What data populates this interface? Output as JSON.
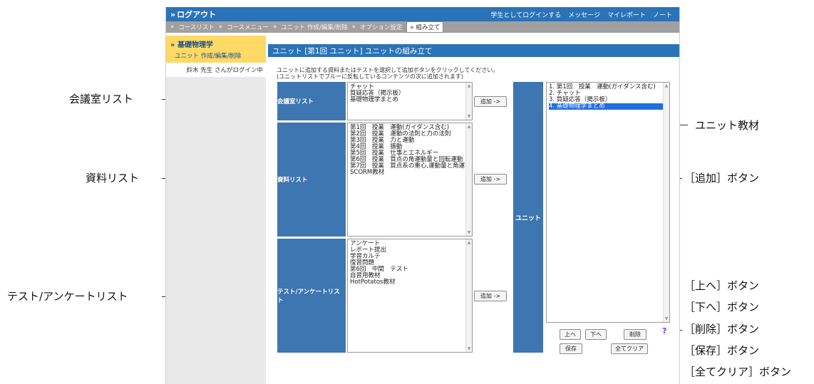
{
  "header": {
    "logout": "ログアウト",
    "links": [
      "学生としてログインする",
      "メッセージ",
      "マイレポート",
      "ノート"
    ]
  },
  "breadcrumb": {
    "items": [
      "コースリスト",
      "コースメニュー",
      "ユニット 作成/編集/削除",
      "オプション設定"
    ],
    "current": "組み立て"
  },
  "sidebar": {
    "course_title": "基礎物理学",
    "sub": "ユニット 作成/編集/削除",
    "login_status": "鈴木 先生 さんがログイン中"
  },
  "main": {
    "title": "ユニット [第1回 ユニット] ユニットの組み立て",
    "instruction_line1": "ユニットに追加する資料またはテストを選択して追加ボタンをクリックしてください。",
    "instruction_line2": "(ユニットリストでブルーに反転しているコンテンツの次に追加されます)"
  },
  "lists": {
    "meeting": {
      "label": "会議室リスト",
      "items": [
        "チャット",
        "質疑応答（掲示板）",
        "基礎物理学まとめ"
      ],
      "add_label": "追加 ->"
    },
    "materials": {
      "label": "資料リスト",
      "items": [
        "第1回　授業　運動(ガイダンス含む)",
        "第2回　授業　運動の法則と力の法則",
        "第3回　授業　力と運動",
        "第4回　授業　振動",
        "第5回　授業　仕事とエネルギー",
        "第6回　授業　質点の角運動量と回転運動",
        "第7回　授業　質点系の重心,運動量と角運",
        "SCORM教材"
      ],
      "add_label": "追加 ->"
    },
    "tests": {
      "label": "テスト/アンケートリスト",
      "items": [
        "アンケート",
        "レポート提出",
        "学習カルテ",
        "復習問題",
        "第6回　中間　テスト",
        "自習用教材",
        "HotPotatos教材"
      ],
      "add_label": "追加 ->"
    }
  },
  "unit": {
    "label": "ユニット",
    "items": [
      "1. 第1回　授業　運動(ガイダンス含む)",
      "2. チャット",
      "3. 質疑応答（掲示板）",
      "4. 基礎物理学まとめ"
    ],
    "selected_index": 3
  },
  "unit_buttons": {
    "up": "上へ",
    "down": "下へ",
    "delete": "削除",
    "save": "保存",
    "clear": "全てクリア",
    "help_icon": "?"
  },
  "callouts": {
    "meeting_list": "会議室リスト",
    "materials_list": "資料リスト",
    "tests_list": "テスト/アンケートリスト",
    "unit_material": "ユニット教材",
    "add_button": "［追加］ボタン",
    "up_button": "［上へ］ボタン",
    "down_button": "［下へ］ボタン",
    "delete_button": "［削除］ボタン",
    "save_button": "［保存］ボタン",
    "clear_button": "［全てクリア］ボタン"
  },
  "colors": {
    "topbar": "#2a73b8",
    "breadcrumb_bg": "#a0a0a0",
    "sidebar_highlight": "#ffd966",
    "category_blue": "#3d76b0",
    "selected_item": "#1f6fe0"
  }
}
